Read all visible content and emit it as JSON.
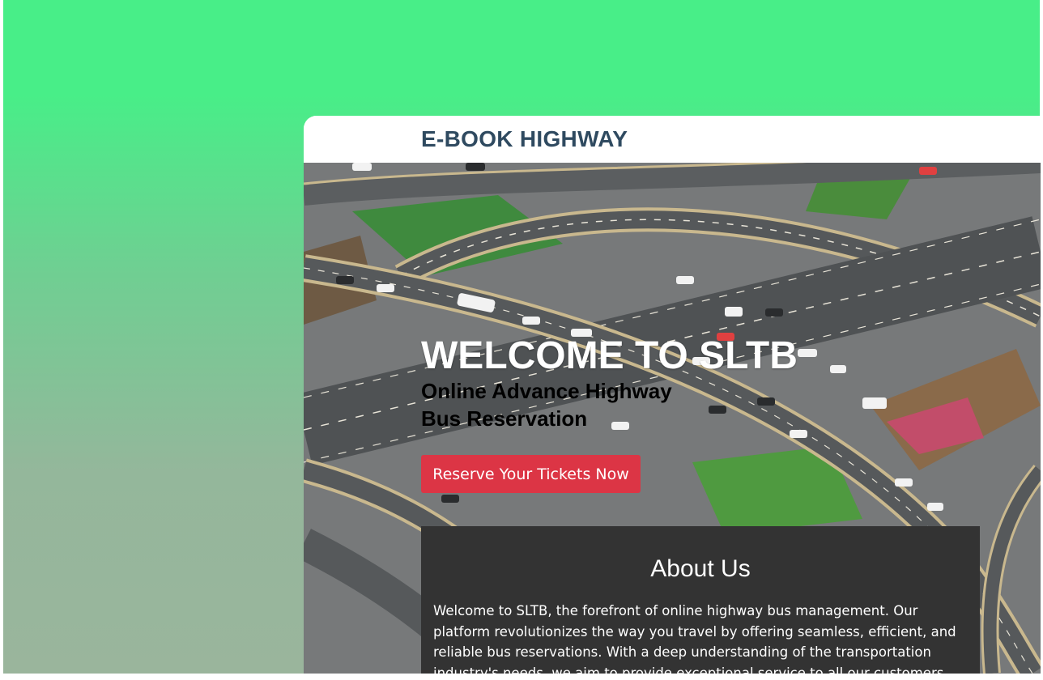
{
  "navbar": {
    "brand": "E-BOOK HIGHWAY"
  },
  "hero": {
    "title": "WELCOME TO SLTB",
    "subtitle_line1": "Online Advance Highway",
    "subtitle_line2": "Bus Reservation",
    "cta_label": "Reserve Your Tickets Now",
    "image": "highway-interchange-aerial"
  },
  "about": {
    "heading": "About Us",
    "text": "Welcome to SLTB, the forefront of online highway bus management. Our platform revolutionizes the way you travel by offering seamless, efficient, and reliable bus reservations. With a deep understanding of the transportation industry's needs, we aim to provide exceptional service to all our customers."
  },
  "colors": {
    "background_top": "#48ee88",
    "background_bottom": "#9ab59c",
    "brand_text": "#2f4a60",
    "cta": "#dc3545",
    "about_bg": "#333333"
  }
}
